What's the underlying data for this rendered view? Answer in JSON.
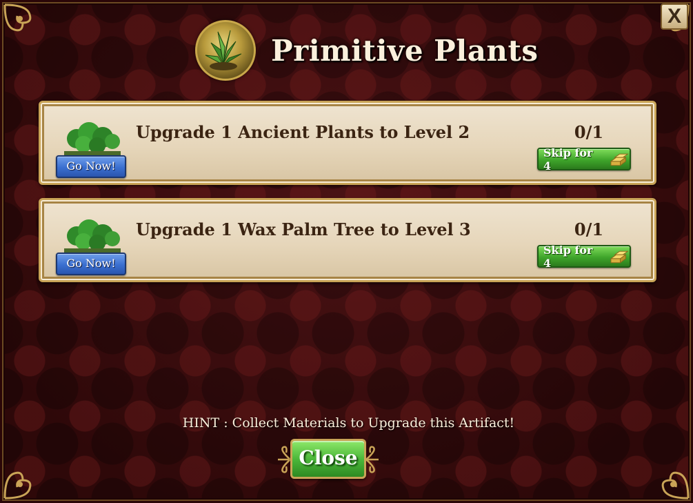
{
  "dialog": {
    "title": "Primitive Plants",
    "close_x_label": "X",
    "header_icon": "plant-artifact-icon"
  },
  "tasks": [
    {
      "text": "Upgrade 1 Ancient Plants to Level 2",
      "progress": "0/1",
      "go_label": "Go Now!",
      "skip_label": "Skip for 4",
      "icon": "ancient-plants-icon"
    },
    {
      "text": "Upgrade 1 Wax Palm Tree to Level 3",
      "progress": "0/1",
      "go_label": "Go Now!",
      "skip_label": "Skip for 4",
      "icon": "wax-palm-tree-icon"
    }
  ],
  "footer": {
    "hint": "HINT : Collect Materials to Upgrade this Artifact!",
    "close_label": "Close"
  },
  "colors": {
    "background": "#3a0b0d",
    "panel": "#e6d6ba",
    "gold_border": "#c9a457",
    "go_button": "#3a6fd0",
    "skip_button": "#3fa52b",
    "close_button": "#4cb83a",
    "title_text": "#fbf0dc",
    "task_text": "#3b2412"
  }
}
